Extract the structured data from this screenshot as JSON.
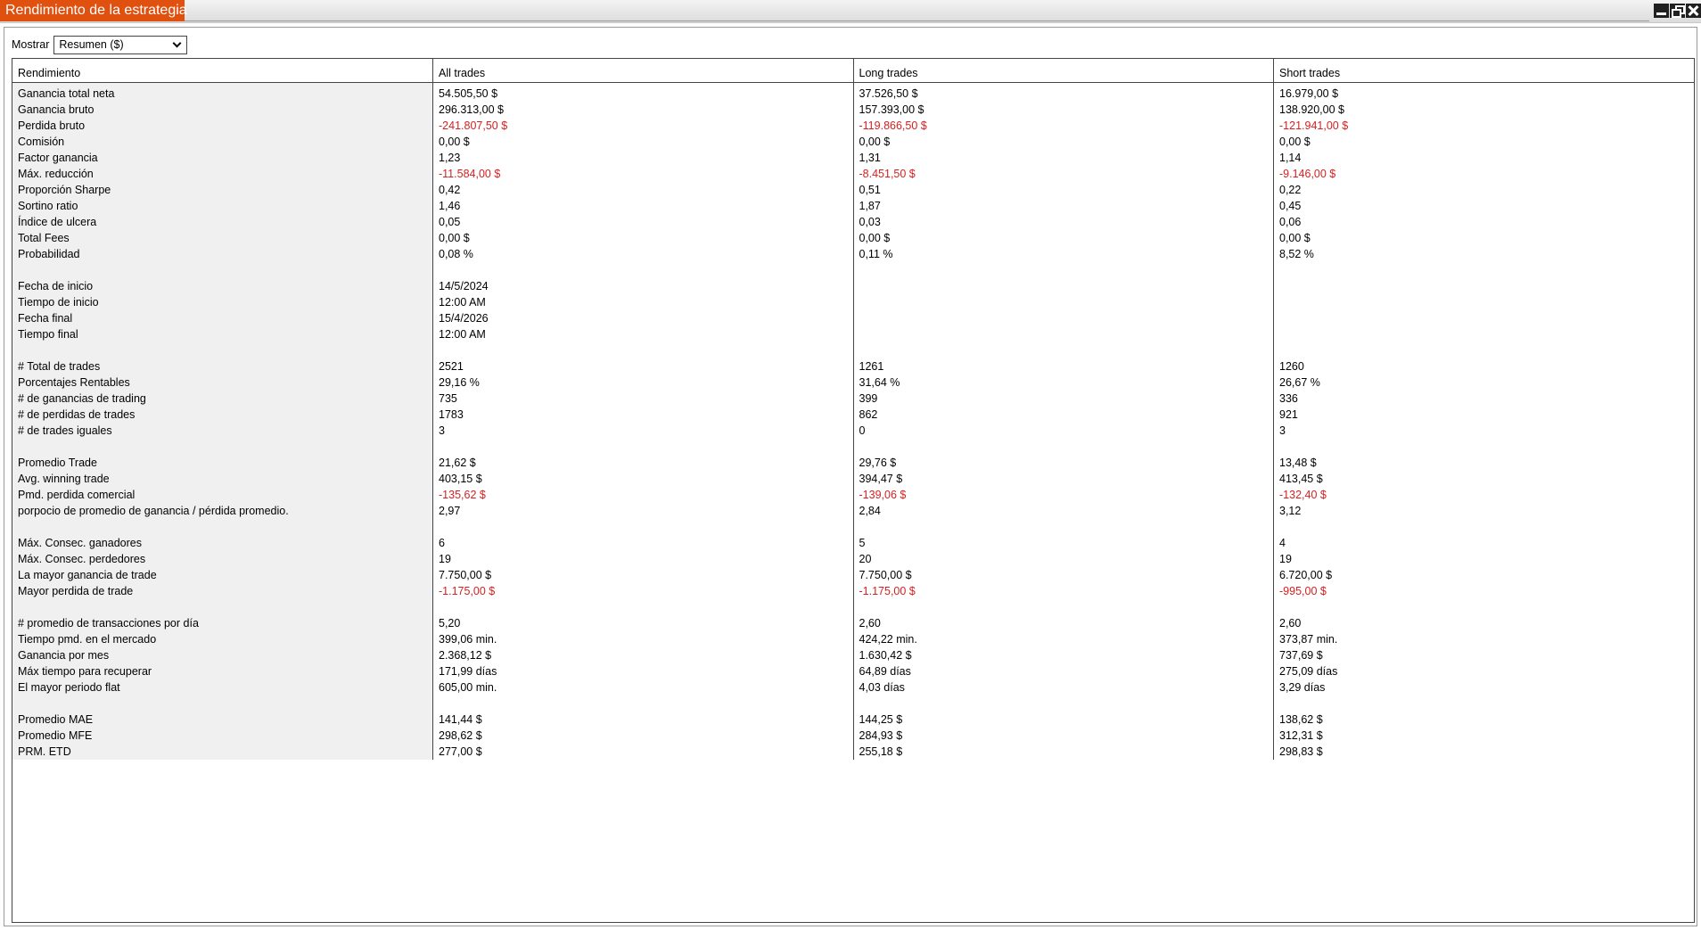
{
  "window": {
    "title": "Rendimiento de la estrategia"
  },
  "toolbar": {
    "show_label": "Mostrar",
    "show_value": "Resumen ($)"
  },
  "columns": [
    "Rendimiento",
    "All trades",
    "Long trades",
    "Short trades"
  ],
  "rows": [
    {
      "label": "Ganancia total neta",
      "all": "54.505,50 $",
      "long": "37.526,50 $",
      "short": "16.979,00 $"
    },
    {
      "label": "Ganancia bruto",
      "all": "296.313,00 $",
      "long": "157.393,00 $",
      "short": "138.920,00 $"
    },
    {
      "label": "Perdida bruto",
      "all": "-241.807,50 $",
      "long": "-119.866,50 $",
      "short": "-121.941,00 $",
      "negative": true
    },
    {
      "label": "Comisión",
      "all": "0,00 $",
      "long": "0,00 $",
      "short": "0,00 $"
    },
    {
      "label": "Factor ganancia",
      "all": "1,23",
      "long": "1,31",
      "short": "1,14"
    },
    {
      "label": "Máx. reducción",
      "all": "-11.584,00 $",
      "long": "-8.451,50 $",
      "short": "-9.146,00 $",
      "negative": true
    },
    {
      "label": "Proporción Sharpe",
      "all": "0,42",
      "long": "0,51",
      "short": "0,22"
    },
    {
      "label": "Sortino ratio",
      "all": "1,46",
      "long": "1,87",
      "short": "0,45"
    },
    {
      "label": "Índice de ulcera",
      "all": "0,05",
      "long": "0,03",
      "short": "0,06"
    },
    {
      "label": "Total Fees",
      "all": "0,00 $",
      "long": "0,00 $",
      "short": "0,00 $"
    },
    {
      "label": "Probabilidad",
      "all": "0,08 %",
      "long": "0,11 %",
      "short": "8,52 %"
    },
    {
      "label": "",
      "all": "",
      "long": "",
      "short": ""
    },
    {
      "label": "Fecha de inicio",
      "all": "14/5/2024",
      "long": "",
      "short": ""
    },
    {
      "label": "Tiempo de inicio",
      "all": "12:00 AM",
      "long": "",
      "short": ""
    },
    {
      "label": "Fecha final",
      "all": "15/4/2026",
      "long": "",
      "short": ""
    },
    {
      "label": "Tiempo final",
      "all": "12:00 AM",
      "long": "",
      "short": ""
    },
    {
      "label": "",
      "all": "",
      "long": "",
      "short": ""
    },
    {
      "label": "# Total de trades",
      "all": "2521",
      "long": "1261",
      "short": "1260"
    },
    {
      "label": "Porcentajes Rentables",
      "all": "29,16 %",
      "long": "31,64 %",
      "short": "26,67 %"
    },
    {
      "label": "# de ganancias de trading",
      "all": "735",
      "long": "399",
      "short": "336"
    },
    {
      "label": "# de perdidas de trades",
      "all": "1783",
      "long": "862",
      "short": "921"
    },
    {
      "label": "# de trades iguales",
      "all": "3",
      "long": "0",
      "short": "3"
    },
    {
      "label": "",
      "all": "",
      "long": "",
      "short": ""
    },
    {
      "label": "Promedio Trade",
      "all": "21,62 $",
      "long": "29,76 $",
      "short": "13,48 $"
    },
    {
      "label": "Avg. winning trade",
      "all": "403,15 $",
      "long": "394,47 $",
      "short": "413,45 $"
    },
    {
      "label": "Pmd. perdida comercial",
      "all": "-135,62 $",
      "long": "-139,06 $",
      "short": "-132,40 $",
      "negative": true
    },
    {
      "label": "porpocio de promedio de ganancia / pérdida promedio.",
      "all": "2,97",
      "long": "2,84",
      "short": "3,12"
    },
    {
      "label": "",
      "all": "",
      "long": "",
      "short": ""
    },
    {
      "label": "Máx. Consec. ganadores",
      "all": "6",
      "long": "5",
      "short": "4"
    },
    {
      "label": "Máx. Consec. perdedores",
      "all": "19",
      "long": "20",
      "short": "19"
    },
    {
      "label": "La mayor ganancia de trade",
      "all": "7.750,00 $",
      "long": "7.750,00 $",
      "short": "6.720,00 $"
    },
    {
      "label": "Mayor perdida de trade",
      "all": "-1.175,00 $",
      "long": "-1.175,00 $",
      "short": "-995,00 $",
      "negative": true
    },
    {
      "label": "",
      "all": "",
      "long": "",
      "short": ""
    },
    {
      "label": "# promedio de transacciones por día",
      "all": "5,20",
      "long": "2,60",
      "short": "2,60"
    },
    {
      "label": "Tiempo pmd. en el mercado",
      "all": "399,06 min.",
      "long": "424,22 min.",
      "short": "373,87 min."
    },
    {
      "label": "Ganancia por mes",
      "all": "2.368,12 $",
      "long": "1.630,42 $",
      "short": "737,69 $"
    },
    {
      "label": "Máx tiempo para recuperar",
      "all": "171,99 días",
      "long": "64,89 días",
      "short": "275,09 días"
    },
    {
      "label": "El mayor periodo flat",
      "all": "605,00 min.",
      "long": "4,03 días",
      "short": "3,29 días"
    },
    {
      "label": "",
      "all": "",
      "long": "",
      "short": ""
    },
    {
      "label": "Promedio MAE",
      "all": "141,44 $",
      "long": "144,25 $",
      "short": "138,62 $"
    },
    {
      "label": "Promedio MFE",
      "all": "298,62 $",
      "long": "284,93 $",
      "short": "312,31 $"
    },
    {
      "label": "PRM. ETD",
      "all": "277,00 $",
      "long": "255,18 $",
      "short": "298,83 $"
    }
  ]
}
